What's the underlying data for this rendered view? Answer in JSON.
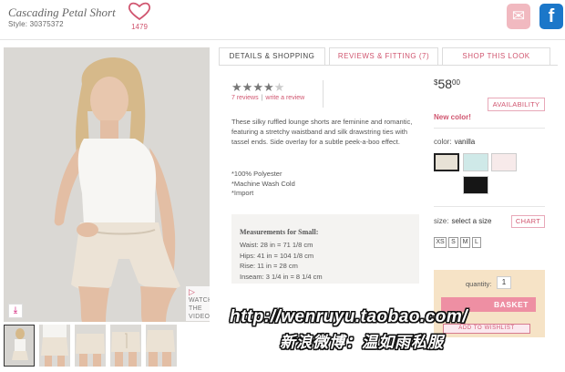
{
  "product": {
    "title": "Cascading Petal Short",
    "style": "Style: 30375372",
    "likes": "1479"
  },
  "icons": {
    "heart": "heart-outline-icon",
    "email": "envelope-icon",
    "facebook": "facebook-icon",
    "facebook_glyph": "f",
    "email_glyph": "✉",
    "download_glyph": "⤓",
    "play_glyph": "▷"
  },
  "gallery": {
    "watch_video": [
      "WATCH",
      "THE",
      "VIDEO"
    ]
  },
  "tabs": [
    "DETAILS & SHOPPING",
    "REVIEWS & FITTING (7)",
    "SHOP THIS LOOK"
  ],
  "reviews": {
    "rating": 4.5,
    "max": 5,
    "count_text": "7 reviews",
    "separator": "|",
    "write_text": "write a review"
  },
  "description": "These silky ruffled lounge shorts are feminine and romantic, featuring a stretchy waistband and silk drawstring ties with tassel ends. Side overlay for a subtle peek-a-boo effect.",
  "features": [
    "*100% Polyester",
    "*Machine Wash Cold",
    "*Import"
  ],
  "measurements": {
    "heading": "Measurements for Small:",
    "lines": [
      "Waist: 28 in = 71 1/8 cm",
      "Hips: 41 in = 104 1/8 cm",
      "Rise: 11 in = 28 cm",
      "Inseam: 3 1/4 in = 8 1/4 cm"
    ]
  },
  "price": {
    "currency": "$",
    "main": "58",
    "cents": "00"
  },
  "availability_label": "AVAILABILITY",
  "new_color": "New color!",
  "color": {
    "label": "color:",
    "selected": "vanilla",
    "swatches": [
      "#e8e2d6",
      "#cfe9e8",
      "#f7eaea",
      "#161616"
    ]
  },
  "size": {
    "label": "size:",
    "selected": "select a size",
    "chart_label": "CHART",
    "options": [
      "XS",
      "S",
      "M",
      "L"
    ]
  },
  "cart": {
    "quantity_label": "quantity:",
    "quantity": "1",
    "add_label": "BASKET",
    "wishlist_label": "ADD TO WISHLIST"
  },
  "watermark": {
    "line1": "http://wenruyu.taobao.com/",
    "line2": "新浪微博：温如雨私服"
  },
  "colors": {
    "accent": "#d0556f",
    "facebook": "#1b77c9",
    "cart_bg": "#f6e3c6"
  }
}
